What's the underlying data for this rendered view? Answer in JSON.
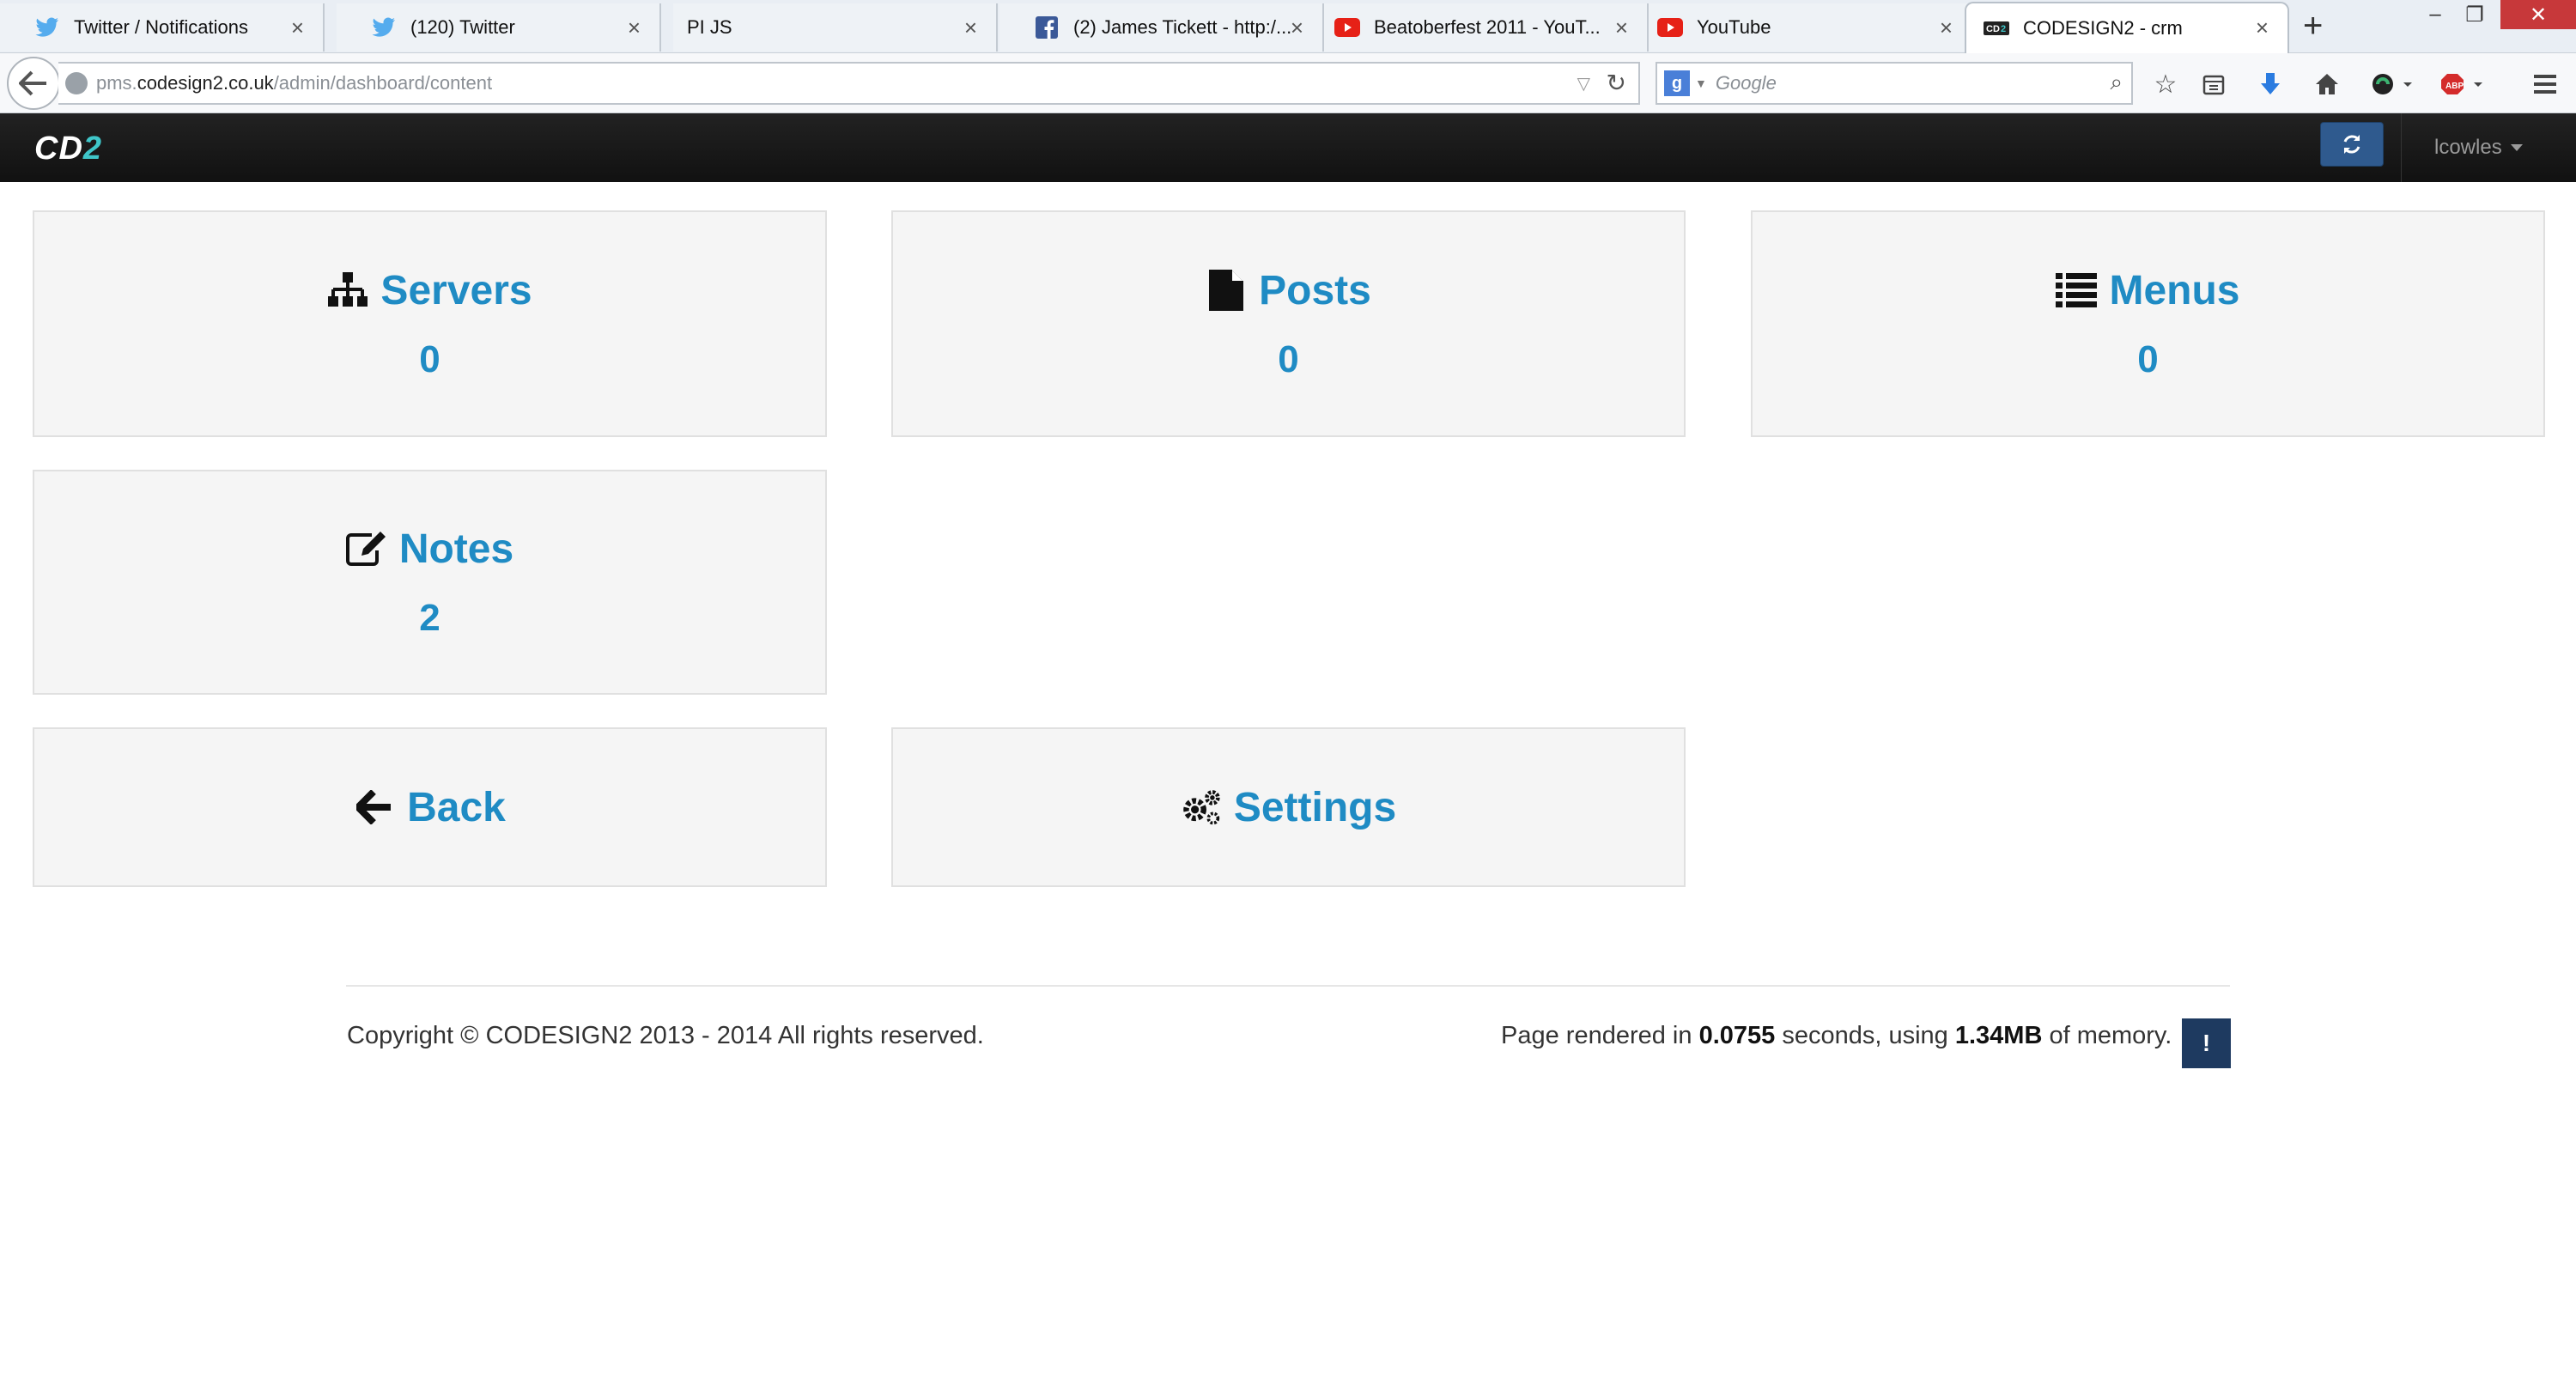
{
  "browser": {
    "tabs": [
      {
        "title": "Twitter / Notifications",
        "favicon": "twitter-bird-icon",
        "active": false
      },
      {
        "title": "(120) Twitter",
        "favicon": "twitter-bird-icon",
        "active": false
      },
      {
        "title": "PI JS",
        "favicon": "",
        "active": false
      },
      {
        "title": "(2) James Tickett - http:/...",
        "favicon": "facebook-icon",
        "active": false
      },
      {
        "title": "Beatoberfest 2011 - YouT...",
        "favicon": "youtube-icon",
        "active": false
      },
      {
        "title": "YouTube",
        "favicon": "youtube-icon",
        "active": false
      },
      {
        "title": "CODESIGN2 - crm",
        "favicon": "cd2-icon",
        "active": true
      }
    ],
    "url": {
      "prefix": "pms.",
      "domain": "codesign2.co.uk",
      "path": "/admin/dashboard/content"
    },
    "search_placeholder": "Google",
    "colors": {
      "twitter": "#55acee",
      "facebook": "#3b5998",
      "youtube": "#e62117",
      "download": "#2a7be0",
      "abp": "#d42b2b"
    }
  },
  "app": {
    "brand": {
      "main": "CD",
      "accent": "2"
    },
    "user": "lcowles"
  },
  "tiles": {
    "servers": {
      "label": "Servers",
      "count": "0"
    },
    "posts": {
      "label": "Posts",
      "count": "0"
    },
    "menus": {
      "label": "Menus",
      "count": "0"
    },
    "notes": {
      "label": "Notes",
      "count": "2"
    },
    "back": {
      "label": "Back"
    },
    "settings": {
      "label": "Settings"
    }
  },
  "footer": {
    "copyright": "Copyright © CODESIGN2 2013 - 2014 All rights reserved.",
    "render_prefix": "Page rendered in ",
    "render_time": "0.0755",
    "render_mid": " seconds, using ",
    "render_memory": "1.34MB",
    "render_suffix": " of memory.",
    "debug_label": "!"
  },
  "accent_color": "#1f8bc4"
}
